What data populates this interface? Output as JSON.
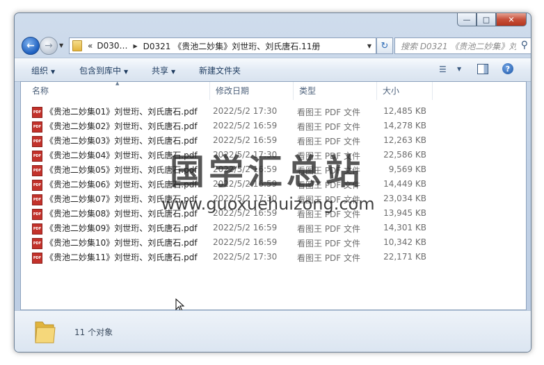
{
  "address": {
    "collapse": "«",
    "parent": "D030…",
    "current": "D0321 《贵池二妙集》刘世珩、刘氏唐石.11册"
  },
  "search": {
    "placeholder": "搜索 D0321 《贵池二妙集》刘..."
  },
  "toolbar": {
    "organize": "组织",
    "include_library": "包含到库中",
    "share": "共享",
    "new_folder": "新建文件夹"
  },
  "columns": {
    "name": "名称",
    "modified": "修改日期",
    "type": "类型",
    "size": "大小"
  },
  "files": [
    {
      "name": "《贵池二妙集01》刘世珩、刘氏唐石.pdf",
      "modified": "2022/5/2 17:30",
      "type": "看图王 PDF 文件",
      "size": "12,485 KB"
    },
    {
      "name": "《贵池二妙集02》刘世珩、刘氏唐石.pdf",
      "modified": "2022/5/2 16:59",
      "type": "看图王 PDF 文件",
      "size": "14,278 KB"
    },
    {
      "name": "《贵池二妙集03》刘世珩、刘氏唐石.pdf",
      "modified": "2022/5/2 16:59",
      "type": "看图王 PDF 文件",
      "size": "12,263 KB"
    },
    {
      "name": "《贵池二妙集04》刘世珩、刘氏唐石.pdf",
      "modified": "2022/5/2 17:30",
      "type": "看图王 PDF 文件",
      "size": "22,586 KB"
    },
    {
      "name": "《贵池二妙集05》刘世珩、刘氏唐石.pdf",
      "modified": "2022/5/2 16:59",
      "type": "看图王 PDF 文件",
      "size": "9,569 KB"
    },
    {
      "name": "《贵池二妙集06》刘世珩、刘氏唐石.pdf",
      "modified": "2022/5/2 16:59",
      "type": "看图王 PDF 文件",
      "size": "14,449 KB"
    },
    {
      "name": "《贵池二妙集07》刘世珩、刘氏唐石.pdf",
      "modified": "2022/5/2 17:30",
      "type": "看图王 PDF 文件",
      "size": "23,034 KB"
    },
    {
      "name": "《贵池二妙集08》刘世珩、刘氏唐石.pdf",
      "modified": "2022/5/2 16:59",
      "type": "看图王 PDF 文件",
      "size": "13,945 KB"
    },
    {
      "name": "《贵池二妙集09》刘世珩、刘氏唐石.pdf",
      "modified": "2022/5/2 16:59",
      "type": "看图王 PDF 文件",
      "size": "14,301 KB"
    },
    {
      "name": "《贵池二妙集10》刘世珩、刘氏唐石.pdf",
      "modified": "2022/5/2 16:59",
      "type": "看图王 PDF 文件",
      "size": "10,342 KB"
    },
    {
      "name": "《贵池二妙集11》刘世珩、刘氏唐石.pdf",
      "modified": "2022/5/2 17:30",
      "type": "看图王 PDF 文件",
      "size": "22,171 KB"
    }
  ],
  "status": {
    "count": "11 个对象"
  },
  "watermark": {
    "title": "国学汇总站",
    "url": "www.guoxuehuizong.com"
  }
}
